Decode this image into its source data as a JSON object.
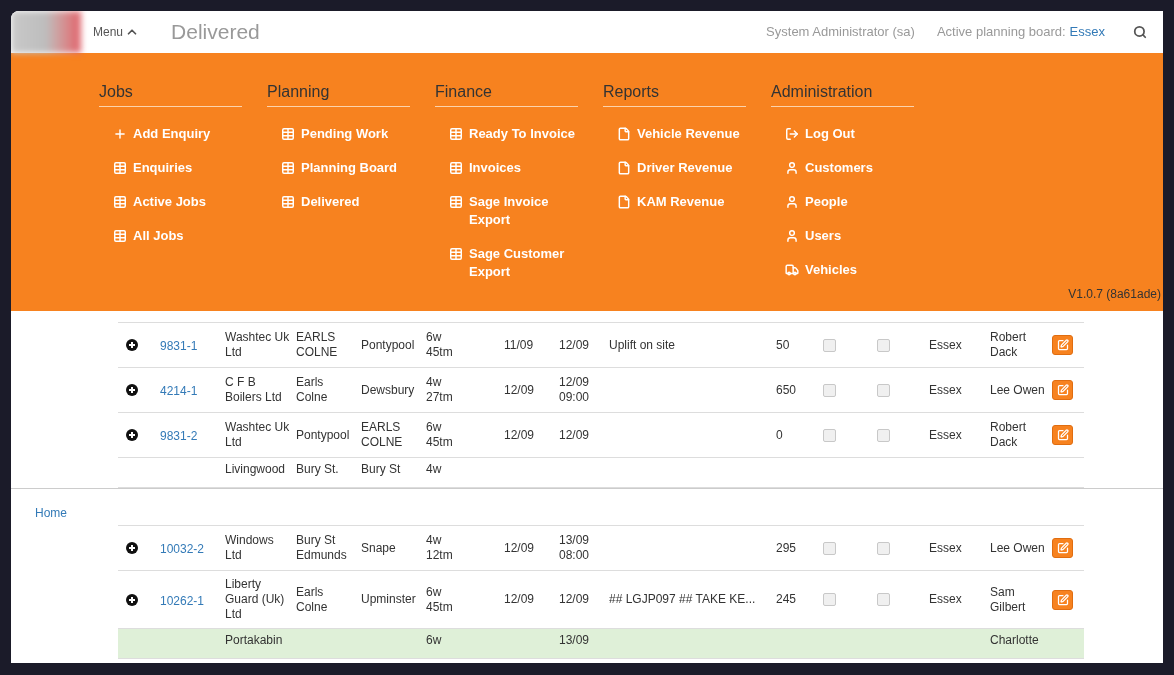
{
  "header": {
    "menu_label": "Menu",
    "page_title": "Delivered",
    "user": "System Administrator (sa)",
    "board_label": "Active planning board:",
    "board_value": "Essex"
  },
  "menu": {
    "sections": [
      {
        "title": "Jobs",
        "items": [
          {
            "kind": "add",
            "label": "Add Enquiry"
          },
          {
            "kind": "table",
            "label": "Enquiries"
          },
          {
            "kind": "table",
            "label": "Active Jobs"
          },
          {
            "kind": "table",
            "label": "All Jobs"
          }
        ]
      },
      {
        "title": "Planning",
        "items": [
          {
            "kind": "table",
            "label": "Pending Work"
          },
          {
            "kind": "table",
            "label": "Planning Board"
          },
          {
            "kind": "table",
            "label": "Delivered"
          }
        ]
      },
      {
        "title": "Finance",
        "items": [
          {
            "kind": "table",
            "label": "Ready To Invoice"
          },
          {
            "kind": "table",
            "label": "Invoices"
          },
          {
            "kind": "table",
            "label": "Sage Invoice Export"
          },
          {
            "kind": "table",
            "label": "Sage Customer Export"
          }
        ]
      },
      {
        "title": "Reports",
        "items": [
          {
            "kind": "file",
            "label": "Vehicle Revenue"
          },
          {
            "kind": "file",
            "label": "Driver Revenue"
          },
          {
            "kind": "file",
            "label": "KAM Revenue"
          }
        ]
      },
      {
        "title": "Administration",
        "items": [
          {
            "kind": "logout",
            "label": "Log Out"
          },
          {
            "kind": "user",
            "label": "Customers"
          },
          {
            "kind": "user",
            "label": "People"
          },
          {
            "kind": "user",
            "label": "Users"
          },
          {
            "kind": "truck",
            "label": "Vehicles"
          }
        ]
      }
    ],
    "version": "V1.0.7 (8a61ade)"
  },
  "table_top": {
    "rows": [
      {
        "kind": "full",
        "highlighted": false,
        "job": "9831-1",
        "customer": "Washtec Uk Ltd",
        "from": "EARLS COLNE",
        "to": "Pontypool",
        "duration": "6w 45tm",
        "collection": "11/09",
        "delivery": "12/09",
        "notes": "Uplift on site",
        "quantity": "50",
        "check_a": false,
        "check_b": false,
        "board": "Essex",
        "driver": "Robert Dack"
      },
      {
        "kind": "full",
        "highlighted": false,
        "job": "4214-1",
        "customer": "C F B Boilers Ltd",
        "from": "Earls Colne",
        "to": "Dewsbury",
        "duration": "4w 27tm",
        "collection": "12/09",
        "delivery": "12/09 09:00",
        "quantity": "650",
        "check_a": false,
        "check_b": false,
        "board": "Essex",
        "driver": "Lee Owen"
      },
      {
        "kind": "full",
        "highlighted": false,
        "job": "9831-2",
        "customer": "Washtec Uk Ltd",
        "from": "Pontypool",
        "to": "EARLS COLNE",
        "duration": "6w 45tm",
        "collection": "12/09",
        "delivery": "12/09",
        "quantity": "0",
        "check_a": false,
        "check_b": false,
        "board": "Essex",
        "driver": "Robert Dack"
      },
      {
        "kind": "partial",
        "highlighted": false,
        "customer": "Livingwood",
        "from": "Bury St.",
        "to": "Bury St",
        "duration": "4w"
      }
    ]
  },
  "breadcrumb": {
    "home": "Home"
  },
  "table_bottom": {
    "rows": [
      {
        "kind": "full",
        "highlighted": false,
        "job": "10032-2",
        "customer": "Windows Ltd",
        "from": "Bury St Edmunds",
        "to": "Snape",
        "duration": "4w 12tm",
        "collection": "12/09",
        "delivery": "13/09 08:00",
        "quantity": "295",
        "check_a": false,
        "check_b": false,
        "board": "Essex",
        "driver": "Lee Owen"
      },
      {
        "kind": "full",
        "highlighted": false,
        "job": "10262-1",
        "customer": "Liberty Guard (Uk) Ltd",
        "from": "Earls Colne",
        "to": "Upminster",
        "duration": "6w 45tm",
        "collection": "12/09",
        "delivery": "12/09",
        "notes": "## LGJP097 ## TAKE KE...",
        "quantity": "245",
        "check_a": false,
        "check_b": false,
        "board": "Essex",
        "driver": "Sam Gilbert"
      },
      {
        "kind": "partial",
        "highlighted": true,
        "customer": "Portakabin",
        "duration": "6w",
        "delivery": "13/09",
        "driver": "Charlotte"
      }
    ]
  }
}
